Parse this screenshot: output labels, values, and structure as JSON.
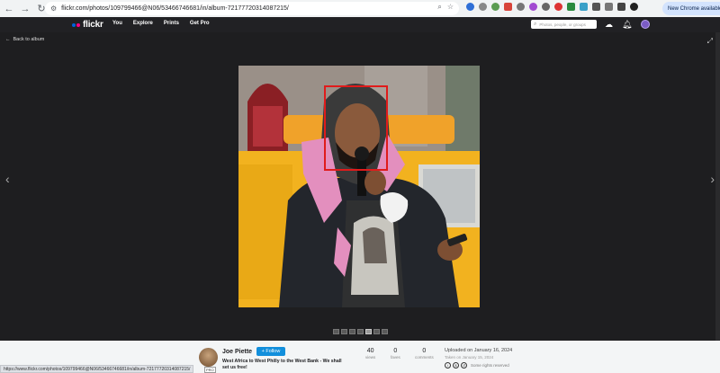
{
  "browser": {
    "url": "flickr.com/photos/109799466@N06/53466746681/in/album-72177720314087215/",
    "update_label": "New Chrome available",
    "status_url": "https://www.flickr.com/photos/109799466@N06/53466746681/in/album-72177720314087215/"
  },
  "header": {
    "logo": "flickr",
    "nav": [
      "You",
      "Explore",
      "Prints",
      "Get Pro"
    ],
    "search_placeholder": "Photos, people, or groups",
    "colors": {
      "logo_blue": "#0063dc",
      "logo_pink": "#ff0084",
      "bar": "#212124"
    }
  },
  "viewer": {
    "back_label": "Back to album",
    "prev_glyph": "‹",
    "next_glyph": "›",
    "overlay_color": "#e01b1b"
  },
  "info": {
    "owner_name": "Joe Piette",
    "pro_badge": "PRO",
    "follow_label": "+ Follow",
    "photo_title": "West Africa to West Philly to the West Bank - We shall set us free!",
    "stats": [
      {
        "value": "40",
        "label": "views"
      },
      {
        "value": "0",
        "label": "faves"
      },
      {
        "value": "0",
        "label": "comments"
      }
    ],
    "uploaded": "Uploaded on January 16, 2024",
    "taken": "Taken on January 15, 2024",
    "license": "Some rights reserved",
    "follow_color": "#128fdc"
  }
}
